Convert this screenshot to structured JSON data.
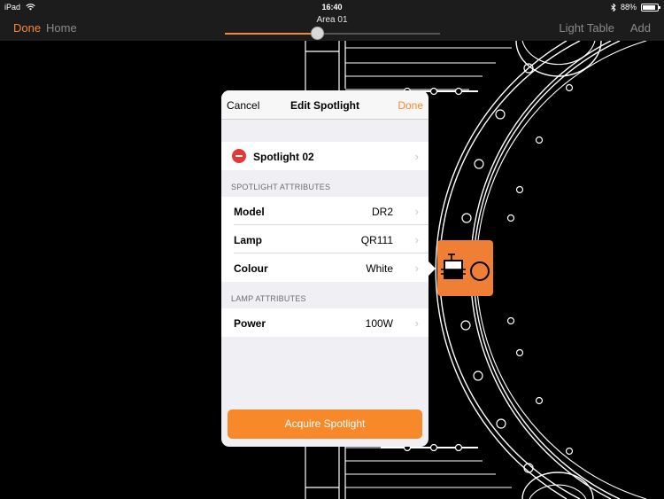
{
  "status_bar": {
    "device": "iPad",
    "time": "16:40",
    "battery": "88%",
    "battery_level": 0.88
  },
  "nav": {
    "done_label": "Done",
    "home_label": "Home",
    "title": "Area 01",
    "light_table_label": "Light Table",
    "add_label": "Add",
    "slider_value": 0.43
  },
  "popover": {
    "cancel_label": "Cancel",
    "title": "Edit Spotlight",
    "done_label": "Done",
    "spotlight_name": "Spotlight 02",
    "spotlight_section": "SPOTLIGHT ATTRIBUTES",
    "attributes": [
      {
        "label": "Model",
        "value": "DR2"
      },
      {
        "label": "Lamp",
        "value": "QR111"
      },
      {
        "label": "Colour",
        "value": "White"
      }
    ],
    "lamp_section": "LAMP ATTRIBUTES",
    "lamp_attributes": [
      {
        "label": "Power",
        "value": "100W"
      }
    ],
    "acquire_label": "Acquire Spotlight"
  },
  "colors": {
    "accent": "#f7892b",
    "destructive": "#e53935",
    "fixture": "#ee7f34"
  },
  "icons": {
    "wifi": "wifi-icon",
    "bluetooth": "bluetooth-icon",
    "battery": "battery-icon",
    "chevron": "chevron-right-icon",
    "delete": "minus-circle-icon",
    "fixture": "spotlight-fixture-icon"
  }
}
